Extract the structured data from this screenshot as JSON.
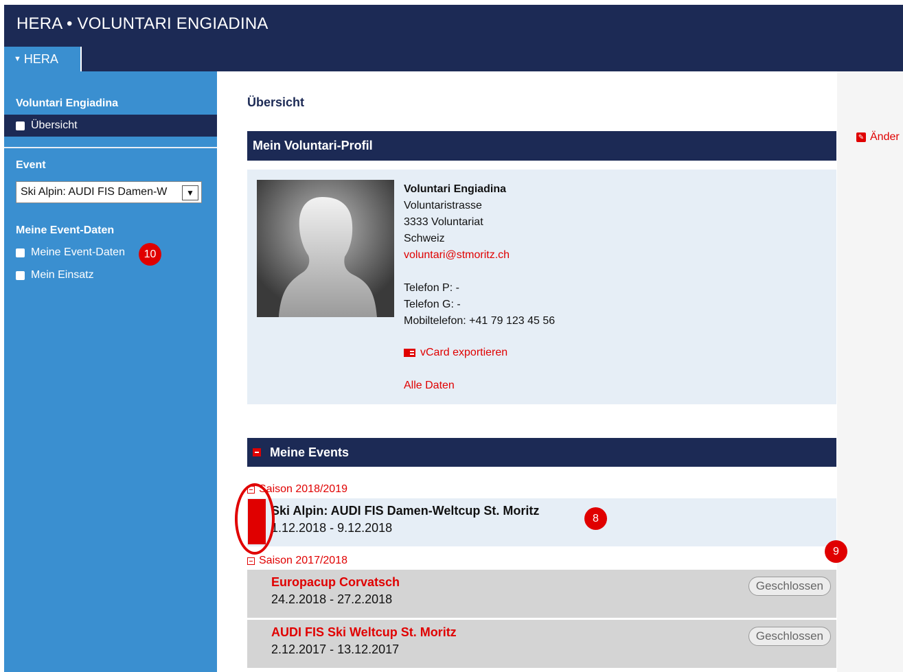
{
  "app": {
    "title": "HERA • VOLUNTARI ENGIADINA",
    "tab": "HERA"
  },
  "sidebar": {
    "section_title": "Voluntari Engiadina",
    "overview_item": "Übersicht",
    "event_heading": "Event",
    "event_select_value": "Ski Alpin: AUDI FIS Damen-W",
    "my_event_heading": "Meine Event-Daten",
    "items": [
      "Meine Event-Daten",
      "Mein Einsatz"
    ]
  },
  "main": {
    "title": "Übersicht",
    "edit_label": "Änder",
    "profile": {
      "heading": "Mein Voluntari-Profil",
      "name": "Voluntari Engiadina",
      "street": "Voluntaristrasse",
      "city": "3333 Voluntariat",
      "country": "Schweiz",
      "email": "voluntari@stmoritz.ch",
      "phone_p": "Telefon P: -",
      "phone_g": "Telefon G: -",
      "mobile": "Mobiltelefon: +41 79 123 45 56",
      "vcard": "vCard exportieren",
      "all_data": "Alle Daten"
    },
    "events": {
      "heading": "Meine Events",
      "seasons": [
        {
          "label": "Saison 2018/2019",
          "events": [
            {
              "name": "Ski Alpin: AUDI FIS Damen-Weltcup St. Moritz",
              "dates": "1.12.2018 - 9.12.2018"
            }
          ]
        },
        {
          "label": "Saison 2017/2018",
          "events": [
            {
              "name": "Europacup Corvatsch",
              "dates": "24.2.2018 - 27.2.2018",
              "status": "Geschlossen"
            },
            {
              "name": "AUDI FIS Ski Weltcup St. Moritz",
              "dates": "2.12.2017 - 13.12.2017",
              "status": "Geschlossen"
            }
          ]
        }
      ]
    }
  },
  "annotations": {
    "badge_a": "10",
    "badge_b": "8",
    "badge_c": "9"
  }
}
